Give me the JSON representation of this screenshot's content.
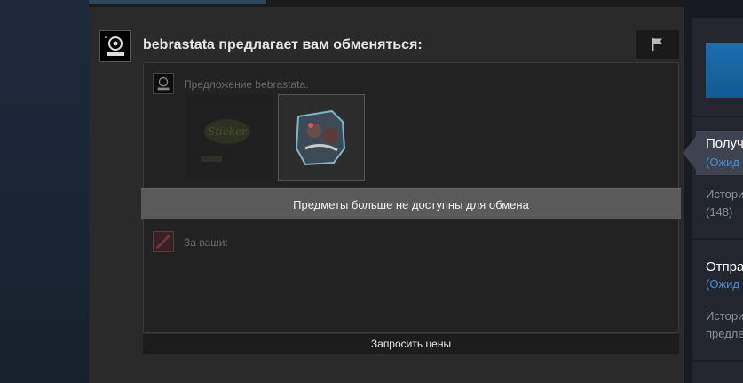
{
  "trade": {
    "title": "bebrastata предлагает вам обменяться:",
    "their_offer_label": "Предложение bebrastata.",
    "your_offer_label": "За ваши:",
    "unavailable_text": "Предметы больше не доступны для обмена",
    "price_button": "Запросить цены"
  },
  "sidebar": {
    "item1_title": "Получ",
    "item1_status": "(Ожид",
    "item1_history": "Истори",
    "item1_count": "(148)",
    "item2_title": "Отпра",
    "item2_status": "(Ожид",
    "item2_history": "Истори",
    "item2_sub": "предле"
  },
  "icons": {
    "flag": "flag-icon",
    "avatar": "avatar-icon"
  },
  "colors": {
    "background": "#1b2838",
    "panel": "#2a2a2a",
    "accent_blue": "#4b8fd6",
    "unavailable_bar": "#5a5a5a"
  }
}
